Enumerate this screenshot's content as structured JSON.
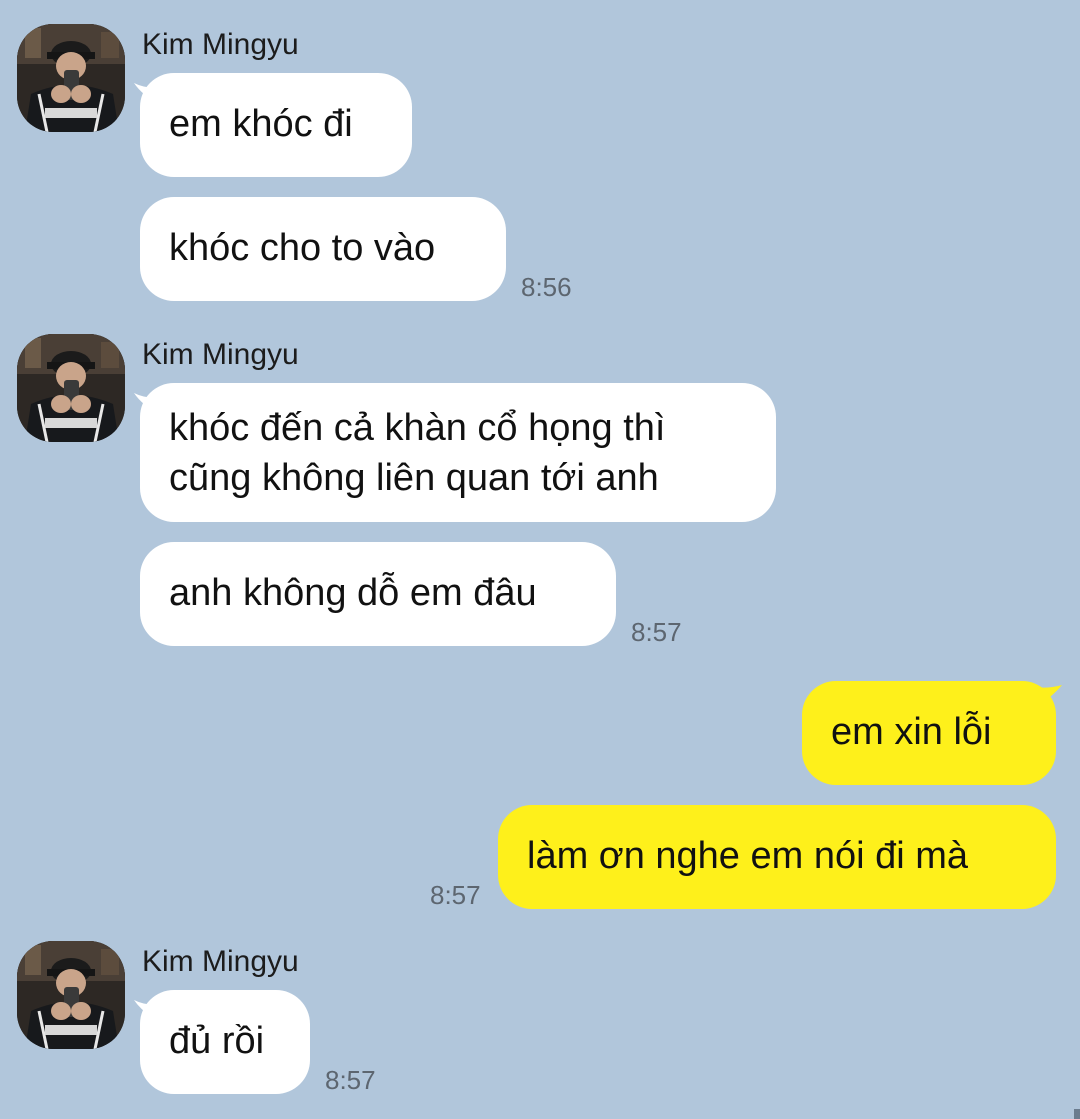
{
  "conversation": {
    "contact_name": "Kim Mingyu",
    "avatar_icon": "profile-photo",
    "colors": {
      "background": "#b1c6db",
      "incoming_bubble": "#ffffff",
      "outgoing_bubble": "#fef01b",
      "timestamp": "#5d6670"
    },
    "groups": [
      {
        "sender": "Kim Mingyu",
        "messages": [
          "em khóc đi",
          "khóc cho to vào"
        ],
        "time": "8:56"
      },
      {
        "sender": "Kim Mingyu",
        "messages": [
          [
            "khóc đến cả khàn cổ họng thì",
            "cũng không liên quan tới anh"
          ],
          "anh không dỗ em đâu"
        ],
        "time": "8:57"
      },
      {
        "sender": "me",
        "messages": [
          "em xin lỗi",
          "làm ơn nghe em nói đi mà"
        ],
        "time": "8:57"
      },
      {
        "sender": "Kim Mingyu",
        "messages": [
          "đủ rồi"
        ],
        "time": "8:57"
      }
    ]
  }
}
